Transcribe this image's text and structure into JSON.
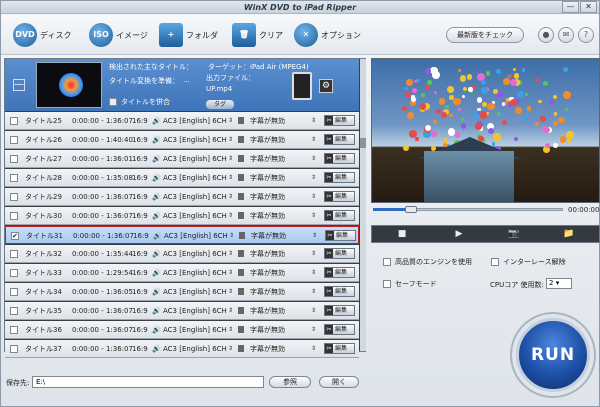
{
  "window": {
    "title": "WinX DVD to iPad Ripper",
    "minimize": "—",
    "close": "✕"
  },
  "toolbar": {
    "disc_label": "ディスク",
    "image_label": "イメージ",
    "folder_label": "フォルダ",
    "clear_label": "クリア",
    "option_label": "オプション",
    "update_label": "最新版をチェック",
    "icons": {
      "dvd": "DVD",
      "iso": "ISO",
      "folder_plus": "+",
      "trash": "🗑",
      "option": "✕"
    }
  },
  "header": {
    "collapse": "—",
    "main_title_label": "検出された主なタイトル：",
    "target_label": "ターゲット：iPad Air (MPEG4)",
    "convert_label": "タイトル変換を準備：",
    "convert_value": "…",
    "output_label": "出力ファイル：",
    "output_file": "UP.mp4",
    "merge_label": "タイトルを併合",
    "tag_button": "タグ",
    "gear": "⚙"
  },
  "rows": [
    {
      "title": "タイトル25",
      "time": "0:00:00 - 1:36:07",
      "aspect": "16:9",
      "audio": "AC3 [English] 6CH",
      "subs": "字幕が無効",
      "edit": "編集",
      "checked": false,
      "selected": false
    },
    {
      "title": "タイトル26",
      "time": "0:00:00 - 1:40:40",
      "aspect": "16:9",
      "audio": "AC3 [English] 6CH",
      "subs": "字幕が無効",
      "edit": "編集",
      "checked": false,
      "selected": false
    },
    {
      "title": "タイトル27",
      "time": "0:00:00 - 1:36:01",
      "aspect": "16:9",
      "audio": "AC3 [English] 6CH",
      "subs": "字幕が無効",
      "edit": "編集",
      "checked": false,
      "selected": false
    },
    {
      "title": "タイトル28",
      "time": "0:00:00 - 1:35:08",
      "aspect": "16:9",
      "audio": "AC3 [English] 6CH",
      "subs": "字幕が無効",
      "edit": "編集",
      "checked": false,
      "selected": false
    },
    {
      "title": "タイトル29",
      "time": "0:00:00 - 1:36:07",
      "aspect": "16:9",
      "audio": "AC3 [English] 6CH",
      "subs": "字幕が無効",
      "edit": "編集",
      "checked": false,
      "selected": false
    },
    {
      "title": "タイトル30",
      "time": "0:00:00 - 1:36:07",
      "aspect": "16:9",
      "audio": "AC3 [English] 6CH",
      "subs": "字幕が無効",
      "edit": "編集",
      "checked": false,
      "selected": false
    },
    {
      "title": "タイトル31",
      "time": "0:00:00 - 1:36:07",
      "aspect": "16:9",
      "audio": "AC3 [English] 6CH",
      "subs": "字幕が無効",
      "edit": "編集",
      "checked": true,
      "selected": true
    },
    {
      "title": "タイトル32",
      "time": "0:00:00 - 1:35:44",
      "aspect": "16:9",
      "audio": "AC3 [English] 6CH",
      "subs": "字幕が無効",
      "edit": "編集",
      "checked": false,
      "selected": false
    },
    {
      "title": "タイトル33",
      "time": "0:00:00 - 1:29:54",
      "aspect": "16:9",
      "audio": "AC3 [English] 6CH",
      "subs": "字幕が無効",
      "edit": "編集",
      "checked": false,
      "selected": false
    },
    {
      "title": "タイトル34",
      "time": "0:00:00 - 1:36:05",
      "aspect": "16:9",
      "audio": "AC3 [English] 6CH",
      "subs": "字幕が無効",
      "edit": "編集",
      "checked": false,
      "selected": false
    },
    {
      "title": "タイトル35",
      "time": "0:00:00 - 1:36:07",
      "aspect": "16:9",
      "audio": "AC3 [English] 6CH",
      "subs": "字幕が無効",
      "edit": "編集",
      "checked": false,
      "selected": false
    },
    {
      "title": "タイトル36",
      "time": "0:00:00 - 1:36:07",
      "aspect": "16:9",
      "audio": "AC3 [English] 6CH",
      "subs": "字幕が無効",
      "edit": "編集",
      "checked": false,
      "selected": false
    },
    {
      "title": "タイトル37",
      "time": "0:00:00 - 1:36:07",
      "aspect": "16:9",
      "audio": "AC3 [English] 6CH",
      "subs": "字幕が無効",
      "edit": "編集",
      "checked": false,
      "selected": false
    }
  ],
  "player": {
    "time": "00:00:00",
    "progress": 0.2,
    "icons": {
      "stop": "■",
      "play": "▶",
      "snapshot": "📷",
      "folder": "📁"
    }
  },
  "options": {
    "hq_engine": "高品質のエンジンを使用",
    "deinterlace": "インターレース解除",
    "safe_mode": "セーフモード",
    "cpu_label": "CPUコア 使用数:",
    "cpu_value": "2"
  },
  "run_label": "RUN",
  "output": {
    "label": "保存先:",
    "path": "E:\\",
    "browse": "参照",
    "open": "開く"
  },
  "colors": {
    "accent": "#3f74b8",
    "selected_border": "#c41e1e",
    "run": "#1c4fa5"
  }
}
